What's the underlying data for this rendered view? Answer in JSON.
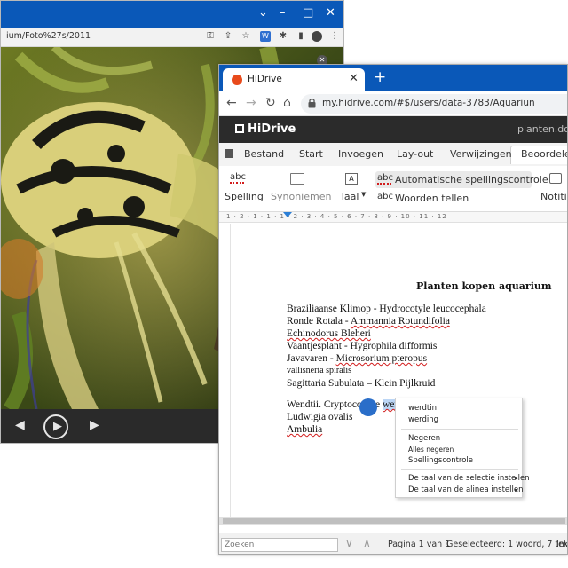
{
  "back_window": {
    "url": "ium/Foto%27s/2011"
  },
  "browser": {
    "tab_title": "HiDrive",
    "url": "my.hidrive.com/#$/users/data-3783/Aquariun"
  },
  "app": {
    "logo": "HiDrive",
    "document_name": "planten.doc"
  },
  "ribbon_tabs": [
    "Bestand",
    "Start",
    "Invoegen",
    "Lay-out",
    "Verwijzingen",
    "Beoordelen"
  ],
  "ribbon": {
    "spelling": "Spelling",
    "synonyms": "Synoniemen",
    "language": "Taal",
    "auto_spell": "Automatische spellingscontrole",
    "word_count": "Woorden tellen",
    "notes": "Notitie",
    "abc": "abc"
  },
  "ruler": "1 · 2 · 1 · 1 · 1 · 2 · 3 · 4 · 5 · 6 · 7 · 8 · 9 · 10 · 11 · 12",
  "document": {
    "heading": "Planten kopen aquarium",
    "lines": {
      "l1a": "Braziliaanse Klimop - Hydrocotyle leucocephala",
      "l2a": "Ronde Rotala - ",
      "l2b": "Ammannia Rotundifolia",
      "l3a": "Echinodorus Bleheri",
      "l4a": "Vaantjesplant - Hygrophila difformis",
      "l5a": "Javavaren - ",
      "l5b": "Microsorium pteropus",
      "l6a": "vallisneria spiralis",
      "l7a": "Sagittaria Subulata – Klein Pijlkruid",
      "l8a": "Wendtii. Cryptocoryne ",
      "l8b": "wendii",
      "l9a": "Ludwigia ovalis",
      "l10a": "Ambulia"
    }
  },
  "context_menu": {
    "suggestion_1": "werdtin",
    "suggestion_2": "werding",
    "ignore": "Negeren",
    "ignore_all": "Alles negeren",
    "spellcheck": "Spellingscontrole",
    "lang_selection": "De taal van de selectie instellen",
    "lang_paragraph": "De taal van de alinea instellen"
  },
  "statusbar": {
    "find_placeholder": "Zoeken",
    "page": "Pagina 1 van 1",
    "selection": "Geselecteerd: 1 woord, 7 tekens",
    "extra": "Invo"
  }
}
